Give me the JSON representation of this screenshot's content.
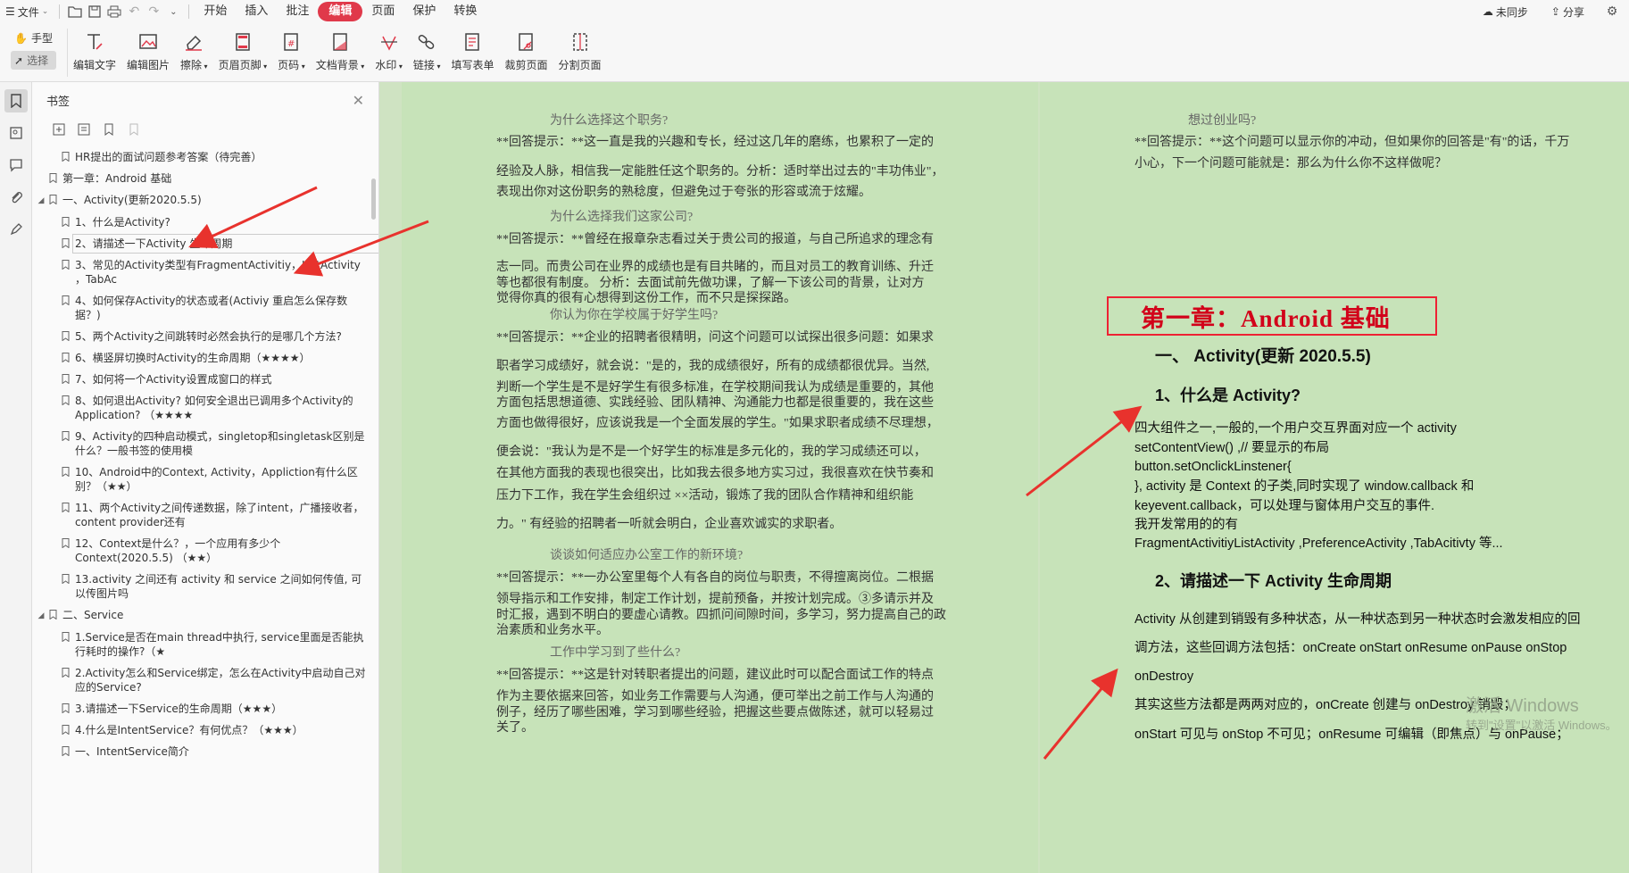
{
  "menubar": {
    "file_label": "文件",
    "tabs": [
      "开始",
      "插入",
      "批注",
      "编辑",
      "页面",
      "保护",
      "转换"
    ],
    "active_tab": "编辑",
    "sync_label": "未同步",
    "share_label": "分享"
  },
  "toolbar": {
    "hand_label": "手型",
    "select_label": "选择",
    "buttons": [
      "编辑文字",
      "编辑图片",
      "擦除",
      "页眉页脚",
      "页码",
      "文档背景",
      "水印",
      "链接",
      "填写表单",
      "裁剪页面",
      "分割页面"
    ]
  },
  "panel": {
    "title": "书签",
    "items": [
      {
        "text": "HR提出的面试问题参考答案（待完善）"
      },
      {
        "text": "第一章：Android 基础"
      },
      {
        "text": "一、Activity(更新2020.5.5)"
      },
      {
        "text": "1、什么是Activity?"
      },
      {
        "text": "2、请描述一下Activity 生命周期"
      },
      {
        "text": "3、常见的Activity类型有FragmentActivitiy，ListActivity ，TabAc"
      },
      {
        "text": "4、如何保存Activity的状态或者(Activiy 重启怎么保存数据？)"
      },
      {
        "text": "5、两个Activity之间跳转时必然会执行的是哪几个方法?"
      },
      {
        "text": "6、横竖屏切换时Activity的生命周期（★★★★）"
      },
      {
        "text": "7、如何将一个Activity设置成窗口的样式"
      },
      {
        "text": "8、如何退出Activity? 如何安全退出已调用多个Activity的Application? （★★★★"
      },
      {
        "text": "9、Activity的四种启动模式，singletop和singletask区别是什么？一般书签的使用模"
      },
      {
        "text": "10、Android中的Context, Activity，Appliction有什么区别？（★★）"
      },
      {
        "text": "11、两个Activity之间传递数据，除了intent，广播接收者，content provider还有"
      },
      {
        "text": "12、Context是什么？，一个应用有多少个Context(2020.5.5) （★★）"
      },
      {
        "text": "13.activity 之间还有 activity 和 service 之间如何传值, 可以传图片吗"
      },
      {
        "text": "二、Service"
      },
      {
        "text": "1.Service是否在main thread中执行, service里面是否能执行耗时的操作?（★"
      },
      {
        "text": "2.Activity怎么和Service绑定，怎么在Activity中启动自己对应的Service?"
      },
      {
        "text": "3.请描述一下Service的生命周期（★★★）"
      },
      {
        "text": "4.什么是IntentService？有何优点？（★★★）"
      },
      {
        "text": "一、IntentService简介"
      }
    ]
  },
  "page1": {
    "lines": [
      "为什么选择这个职务?",
      "**回答提示：**这一直是我的兴趣和专长，经过这几年的磨练，也累积了一定的",
      "经验及人脉，相信我一定能胜任这个职务的。分析：适时举出过去的\"丰功伟业\"，",
      "表现出你对这份职务的熟稔度，但避免过于夸张的形容或流于炫耀。",
      "为什么选择我们这家公司?",
      "**回答提示：**曾经在报章杂志看过关于贵公司的报道，与自己所追求的理念有",
      "志一同。而贵公司在业界的成绩也是有目共睹的，而且对员工的教育训练、升迁",
      "等也都很有制度。 分析：去面试前先做功课，了解一下该公司的背景，让对方",
      "觉得你真的很有心想得到这份工作，而不只是探探路。",
      "你认为你在学校属于好学生吗?",
      "**回答提示：**企业的招聘者很精明，问这个问题可以试探出很多问题：如果求",
      "职者学习成绩好，就会说：\"是的，我的成绩很好，所有的成绩都很优异。当然,",
      "判断一个学生是不是好学生有很多标准，在学校期间我认为成绩是重要的，其他",
      "方面包括思想道德、实践经验、团队精神、沟通能力也都是很重要的，我在这些",
      "方面也做得很好，应该说我是一个全面发展的学生。\"如果求职者成绩不尽理想，",
      "便会说：\"我认为是不是一个好学生的标准是多元化的，我的学习成绩还可以，",
      "在其他方面我的表现也很突出，比如我去很多地方实习过，我很喜欢在快节奏和",
      "压力下工作，我在学生会组织过 ××活动，锻炼了我的团队合作精神和组织能",
      "力。\" 有经验的招聘者一听就会明白，企业喜欢诚实的求职者。",
      "谈谈如何适应办公室工作的新环境?",
      "**回答提示：**一办公室里每个人有各自的岗位与职责，不得擅离岗位。二根据",
      "领导指示和工作安排，制定工作计划，提前预备，并按计划完成。③多请示并及",
      "时汇报，遇到不明白的要虚心请教。四抓问间隙时间，多学习，努力提高自己的政",
      "治素质和业务水平。",
      "工作中学习到了些什么?",
      "**回答提示：**这是针对转职者提出的问题，建议此时可以配合面试工作的特点",
      "作为主要依据来回答，如业务工作需要与人沟通，便可举出之前工作与人沟通的",
      "例子，经历了哪些困难，学习到哪些经验，把握这些要点做陈述，就可以轻易过",
      "关了。"
    ]
  },
  "page2": {
    "q_title": "想过创业吗?",
    "q_line1": "**回答提示：**这个问题可以显示你的冲动，但如果你的回答是\"有\"的话，千万",
    "q_line2": "小心，下一个问题可能就是：那么为什么你不这样做呢？",
    "chapter_title": "第一章：Android 基础",
    "h_activity": "一、  Activity(更新 2020.5.5)",
    "h_what": "1、什么是 Activity?",
    "body1": [
      "四大组件之一,一般的,一个用户交互界面对应一个 activity",
      "setContentView() ,//  要显示的布局",
      "button.setOnclickLinstener{",
      "}, activity  是 Context 的子类,同时实现了 window.callback 和",
      "keyevent.callback，可以处理与窗体用户交互的事件.",
      "我开发常用的的有",
      "FragmentActivitiyListActivity    ,PreferenceActivity ,TabAcitivty 等..."
    ],
    "h_lifecycle": "2、请描述一下 Activity  生命周期",
    "body2": [
      "Activity 从创建到销毁有多种状态，从一种状态到另一种状态时会激发相应的回",
      "调方法，这些回调方法包括：onCreate onStart onResume onPause onStop",
      "onDestroy",
      "其实这些方法都是两两对应的，onCreate 创建与 onDestroy 销毁；",
      "onStart 可见与 onStop 不可见；onResume 可编辑（即焦点）与 onPause；"
    ],
    "watermark_1": "激活 Windows",
    "watermark_2": "转到\"设置\"以激活 Windows。"
  },
  "colors": {
    "accent": "#e0394a",
    "page_bg": "#c7e3b9",
    "arrow": "#e8322d",
    "chapter_red": "#d2001a"
  }
}
